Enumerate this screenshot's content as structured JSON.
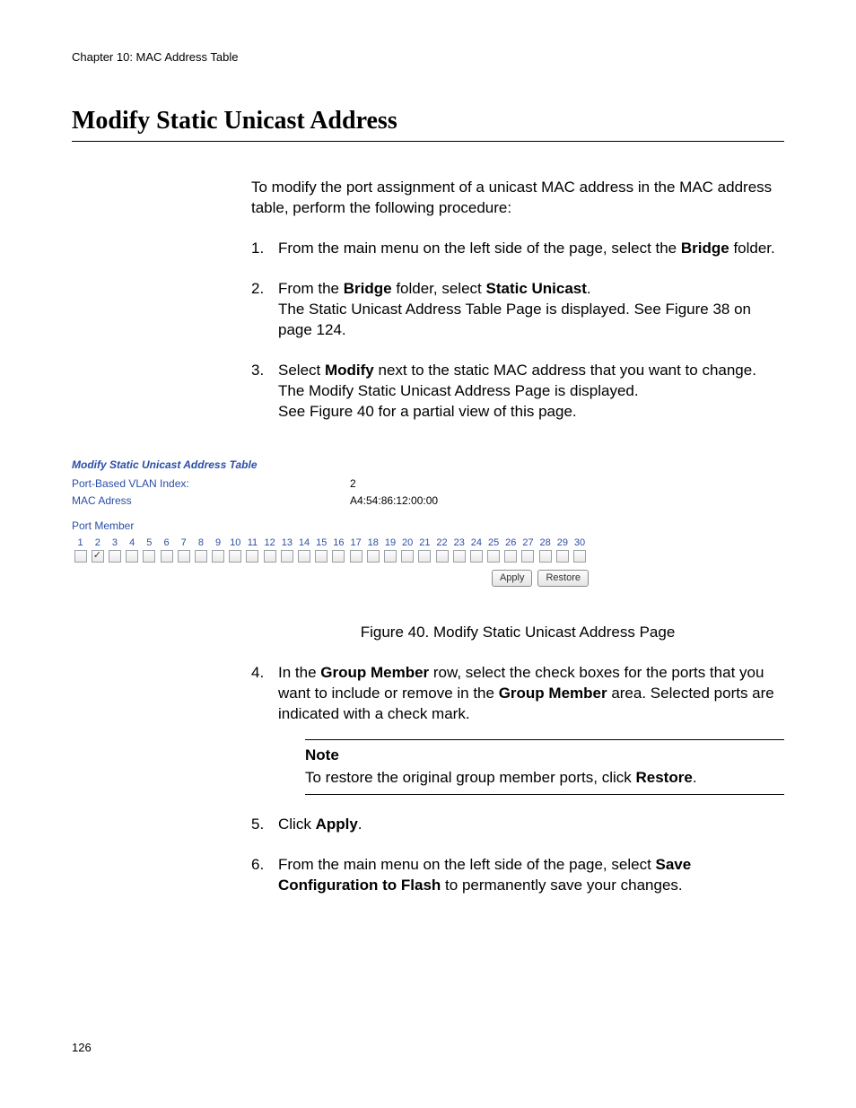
{
  "chapter_header": "Chapter 10: MAC Address Table",
  "main_title": "Modify Static Unicast Address",
  "intro": "To modify the port assignment of a unicast MAC address in the MAC address table, perform the following procedure:",
  "steps": {
    "s1_a": "From the main menu on the left side of the page, select the ",
    "s1_bold": "Bridge",
    "s1_b": " folder.",
    "s2_a": "From the ",
    "s2_bold1": "Bridge",
    "s2_b": " folder, select ",
    "s2_bold2": "Static Unicast",
    "s2_c": ".",
    "s2_line2": "The Static Unicast Address Table Page is displayed. See Figure 38 on page 124.",
    "s3_a": "Select ",
    "s3_bold": "Modify",
    "s3_b": " next to the static MAC address that you want to change. The Modify Static Unicast Address Page is displayed.",
    "s3_line3": "See Figure 40 for a partial view of this page.",
    "s4_a": "In the ",
    "s4_bold1": "Group Member",
    "s4_b": " row, select the check boxes for the ports that you want to include or remove in the ",
    "s4_bold2": "Group Member",
    "s4_c": " area. Selected ports are indicated with a check mark.",
    "s5_a": "Click ",
    "s5_bold": "Apply",
    "s5_b": ".",
    "s6_a": "From the main menu on the left side of the page, select ",
    "s6_bold": "Save Configuration to Flash",
    "s6_b": " to permanently save your changes."
  },
  "figure": {
    "title": "Modify Static Unicast Address Table",
    "vlan_label": "Port-Based VLAN Index:",
    "vlan_value": "2",
    "mac_label": "MAC Adress",
    "mac_value": "A4:54:86:12:00:00",
    "port_member_label": "Port Member",
    "ports": [
      "1",
      "2",
      "3",
      "4",
      "5",
      "6",
      "7",
      "8",
      "9",
      "10",
      "11",
      "12",
      "13",
      "14",
      "15",
      "16",
      "17",
      "18",
      "19",
      "20",
      "21",
      "22",
      "23",
      "24",
      "25",
      "26",
      "27",
      "28",
      "29",
      "30"
    ],
    "checked_port": "2",
    "apply_btn": "Apply",
    "restore_btn": "Restore"
  },
  "figure_caption": "Figure 40. Modify Static Unicast Address Page",
  "note": {
    "title": "Note",
    "text_a": "To restore the original group member ports, click ",
    "text_bold": "Restore",
    "text_b": "."
  },
  "page_number": "126"
}
